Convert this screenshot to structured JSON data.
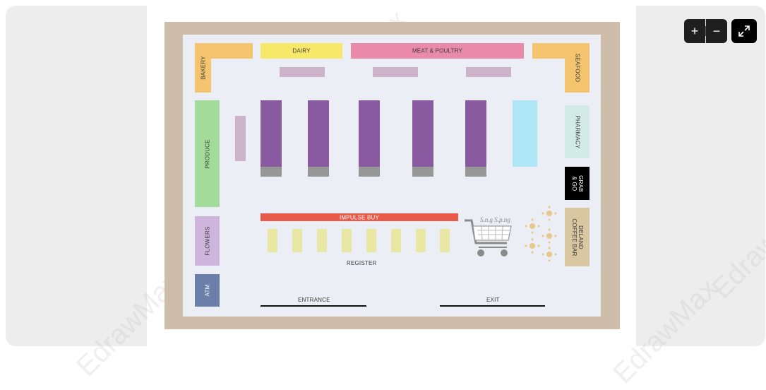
{
  "viewer": {
    "zoom_in_label": "+",
    "zoom_out_label": "−",
    "watermark": "EdrawMax"
  },
  "diagram": {
    "sections": {
      "bakery": "BAKERY",
      "dairy": "DAIRY",
      "meat_poultry": "MEAT & POULTRY",
      "seafood": "SEAFOOD",
      "produce": "PRODUCE",
      "pharmacy": "PHARMACY",
      "grab_go": "GRAB\n& GO",
      "flowers": "FLOWERS",
      "atm": "ATM",
      "coffee_bar": "DELAND\nCOFFEE BAR",
      "impulse_buy": "IMPULSE BUY",
      "register": "REGISTER",
      "entrance": "ENTRANCE",
      "exit": "EXIT",
      "cart_sign": "S.n.g S.p.ng"
    },
    "colors": {
      "bakery": "#f4c46e",
      "dairy": "#f8e86a",
      "meat": "#e98aaa",
      "produce": "#a3dc9a",
      "pharmacy": "#d3ebe6",
      "grab_go": "#000000",
      "flowers": "#cdb5dd",
      "atm": "#6c7fa8",
      "coffee": "#d8c7a1",
      "aisle": "#8a5aa1",
      "endcap": "#979797",
      "lightblue": "#aee6f5",
      "mauve": "#cdb3c9",
      "impulse": "#e85b4a",
      "register": "#e9e7a4",
      "frame": "#cebda9",
      "floor": "#ebeef4"
    }
  }
}
